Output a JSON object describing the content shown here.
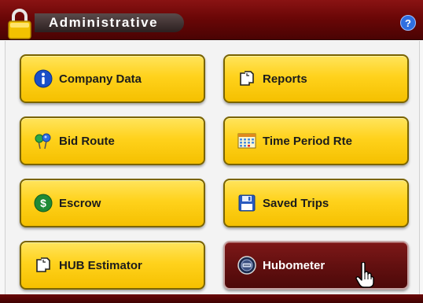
{
  "window": {
    "title": "Administrative"
  },
  "buttons": [
    {
      "label": "Company Data",
      "icon": "info-icon"
    },
    {
      "label": "Reports",
      "icon": "documents-icon"
    },
    {
      "label": "Bid Route",
      "icon": "map-pins-icon"
    },
    {
      "label": "Time Period Rte",
      "icon": "calendar-icon"
    },
    {
      "label": "Escrow",
      "icon": "dollar-icon"
    },
    {
      "label": "Saved Trips",
      "icon": "floppy-disk-icon"
    },
    {
      "label": "HUB Estimator",
      "icon": "documents-icon"
    },
    {
      "label": "Hubometer",
      "icon": "hubometer-icon",
      "state": "selected"
    }
  ],
  "colors": {
    "titlebar": "#6b0707",
    "button_yellow": "#ffd21c",
    "button_selected": "#631010",
    "help_blue": "#2f6fe0"
  }
}
